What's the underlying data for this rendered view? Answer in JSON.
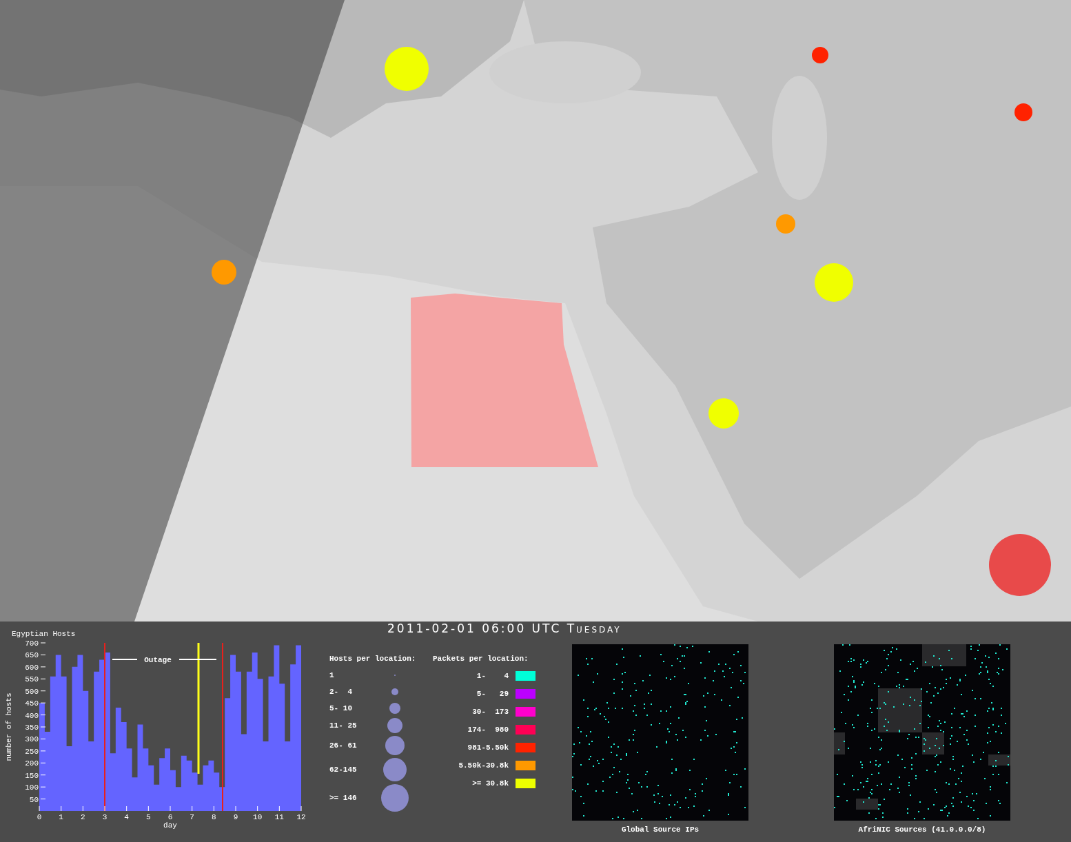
{
  "timestamp": "2011-02-01 06:00 UTC Tuesday",
  "hosts_chart": {
    "chart_data": {
      "type": "area",
      "title": "Egyptian Hosts",
      "xlabel": "day",
      "ylabel": "number of hosts",
      "xlim": [
        0,
        12
      ],
      "ylim": [
        0,
        700
      ],
      "xticks": [
        0,
        1,
        2,
        3,
        4,
        5,
        6,
        7,
        8,
        9,
        10,
        11,
        12
      ],
      "yticks": [
        50,
        100,
        150,
        200,
        250,
        300,
        350,
        400,
        450,
        500,
        550,
        600,
        650,
        700
      ],
      "x": [
        0,
        0.25,
        0.5,
        0.75,
        1,
        1.25,
        1.5,
        1.75,
        2,
        2.25,
        2.5,
        2.75,
        3,
        3.25,
        3.5,
        3.75,
        4,
        4.25,
        4.5,
        4.75,
        5,
        5.25,
        5.5,
        5.75,
        6,
        6.25,
        6.5,
        6.75,
        7,
        7.25,
        7.5,
        7.75,
        8,
        8.25,
        8.5,
        8.75,
        9,
        9.25,
        9.5,
        9.75,
        10,
        10.25,
        10.5,
        10.75,
        11,
        11.25,
        11.5,
        11.75,
        12
      ],
      "values": [
        450,
        330,
        560,
        650,
        560,
        270,
        600,
        650,
        500,
        290,
        580,
        630,
        660,
        240,
        430,
        370,
        260,
        140,
        360,
        260,
        190,
        110,
        220,
        260,
        170,
        100,
        230,
        210,
        160,
        110,
        190,
        210,
        160,
        100,
        470,
        650,
        580,
        320,
        580,
        660,
        550,
        290,
        560,
        690,
        530,
        290,
        610,
        690,
        580
      ],
      "ref_lines": [
        {
          "axis": "x",
          "value": 3
        },
        {
          "axis": "x",
          "value": 8.4
        }
      ]
    },
    "outage_label": "Outage"
  },
  "hosts_legend": {
    "title": "Hosts per location:",
    "items": [
      "1",
      "2-  4",
      "5- 10",
      "11- 25",
      "26- 61",
      "62-145",
      ">= 146"
    ]
  },
  "packets_legend": {
    "title": "Packets per location:",
    "items": [
      {
        "label": "1-    4",
        "color": "#00ffd8"
      },
      {
        "label": "5-   29",
        "color": "#bb00ff"
      },
      {
        "label": "30-  173",
        "color": "#ff00cc"
      },
      {
        "label": "174-  980",
        "color": "#ff0055"
      },
      {
        "label": "981-5.50k",
        "color": "#ff2200"
      },
      {
        "label": "5.50k-30.8k",
        "color": "#ff9900"
      },
      {
        "label": ">= 30.8k",
        "color": "#eeff00"
      }
    ]
  },
  "address_maps": [
    {
      "kind": "picture",
      "caption": "Global Source IPs"
    },
    {
      "kind": "picture",
      "caption": "AfriNIC Sources (41.0.0.0/8)"
    }
  ]
}
